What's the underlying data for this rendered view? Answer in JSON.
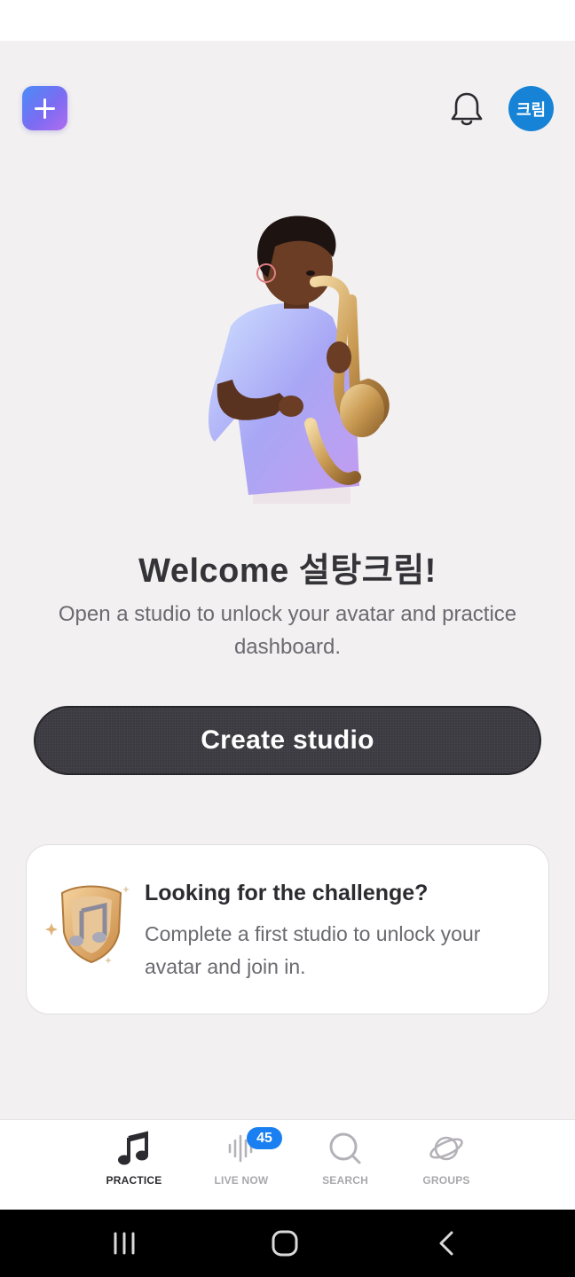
{
  "header": {
    "add_icon": "plus-icon",
    "notification_icon": "bell-icon",
    "avatar_text": "크림",
    "accent_color": "#1683d6"
  },
  "hero": {
    "illustration": "saxophone-player-avatar",
    "title": "Welcome 설탕크림!",
    "subtitle": "Open a studio to unlock your avatar and practice dashboard."
  },
  "primary_action": {
    "label": "Create studio"
  },
  "challenge_card": {
    "icon": "music-note-badge-icon",
    "title": "Looking for the challenge?",
    "text": "Complete a first studio to unlock your avatar and join in."
  },
  "bottom_nav": {
    "items": [
      {
        "label": "PRACTICE",
        "icon": "music-note-icon",
        "active": true
      },
      {
        "label": "LIVE NOW",
        "icon": "soundwave-icon",
        "active": false,
        "badge": "45"
      },
      {
        "label": "SEARCH",
        "icon": "search-icon",
        "active": false
      },
      {
        "label": "GROUPS",
        "icon": "planet-icon",
        "active": false
      }
    ],
    "badge_color": "#1a7ff0"
  },
  "system_nav": {
    "recents_icon": "recents-icon",
    "home_icon": "home-icon",
    "back_icon": "back-icon"
  }
}
